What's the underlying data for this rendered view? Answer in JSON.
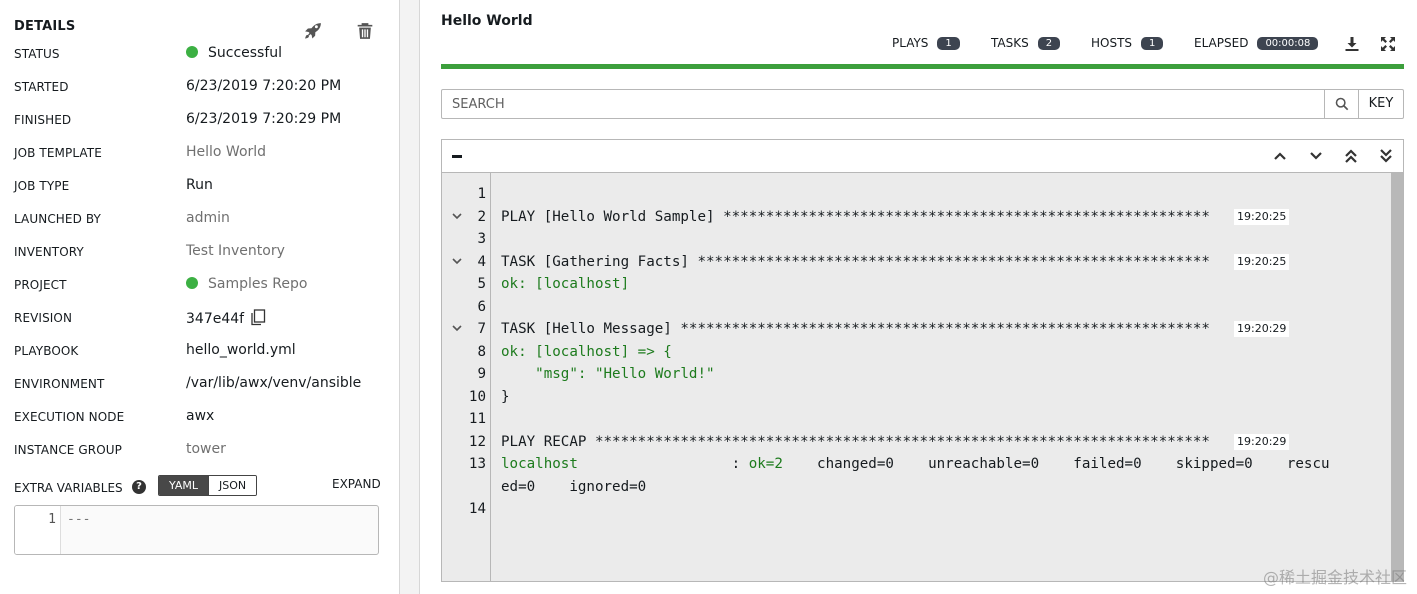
{
  "details": {
    "title": "DETAILS",
    "rows": [
      {
        "label": "STATUS",
        "value": "Successful",
        "link": false
      },
      {
        "label": "STARTED",
        "value": "6/23/2019 7:20:20 PM",
        "link": false
      },
      {
        "label": "FINISHED",
        "value": "6/23/2019 7:20:29 PM",
        "link": false
      },
      {
        "label": "JOB TEMPLATE",
        "value": "Hello World",
        "link": true
      },
      {
        "label": "JOB TYPE",
        "value": "Run",
        "link": false
      },
      {
        "label": "LAUNCHED BY",
        "value": "admin",
        "link": true
      },
      {
        "label": "INVENTORY",
        "value": "Test Inventory",
        "link": true
      },
      {
        "label": "PROJECT",
        "value": "Samples Repo",
        "link": true
      },
      {
        "label": "REVISION",
        "value": "347e44f",
        "link": false
      },
      {
        "label": "PLAYBOOK",
        "value": "hello_world.yml",
        "link": false
      },
      {
        "label": "ENVIRONMENT",
        "value": "/var/lib/awx/venv/ansible",
        "link": false
      },
      {
        "label": "EXECUTION NODE",
        "value": "awx",
        "link": false
      },
      {
        "label": "INSTANCE GROUP",
        "value": "tower",
        "link": true
      }
    ],
    "status_color": "#3cb043",
    "extra_variables": {
      "label": "EXTRA VARIABLES",
      "help": "?",
      "yaml_label": "YAML",
      "json_label": "JSON",
      "active": "YAML",
      "expand_label": "EXPAND",
      "line_number": "1",
      "content": "---"
    }
  },
  "output": {
    "title": "Hello World",
    "stats": {
      "plays_label": "PLAYS",
      "plays": "1",
      "tasks_label": "TASKS",
      "tasks": "2",
      "hosts_label": "HOSTS",
      "hosts": "1",
      "elapsed_label": "ELAPSED",
      "elapsed": "00:00:08"
    },
    "progress": 1.0,
    "progress_color": "#3c9f3c",
    "search": {
      "placeholder": "SEARCH",
      "key_label": "KEY"
    },
    "icons": [
      "download-icon",
      "fullscreen-icon",
      "search-icon",
      "chevron-up-icon",
      "chevron-down-icon",
      "double-chevron-up-icon",
      "double-chevron-down-icon"
    ],
    "log_lines": [
      {
        "n": "1",
        "text": "",
        "green": false,
        "ts": "",
        "fold": false
      },
      {
        "n": "2",
        "text": "PLAY [Hello World Sample] *********************************************************",
        "green": false,
        "ts": "19:20:25",
        "fold": true
      },
      {
        "n": "3",
        "text": "",
        "green": false,
        "ts": "",
        "fold": false
      },
      {
        "n": "4",
        "text": "TASK [Gathering Facts] ************************************************************",
        "green": false,
        "ts": "19:20:25",
        "fold": true
      },
      {
        "n": "5",
        "text": "ok: [localhost]",
        "green": true,
        "ts": "",
        "fold": false
      },
      {
        "n": "6",
        "text": "",
        "green": false,
        "ts": "",
        "fold": false
      },
      {
        "n": "7",
        "text": "TASK [Hello Message] **************************************************************",
        "green": false,
        "ts": "19:20:29",
        "fold": true
      },
      {
        "n": "8",
        "text": "ok: [localhost] => {",
        "green": true,
        "ts": "",
        "fold": false
      },
      {
        "n": "9",
        "text": "    \"msg\": \"Hello World!\"",
        "green": true,
        "ts": "",
        "fold": false
      },
      {
        "n": "10",
        "text": "}",
        "green": false,
        "ts": "",
        "fold": false
      },
      {
        "n": "11",
        "text": "",
        "green": false,
        "ts": "",
        "fold": false
      },
      {
        "n": "12",
        "text": "PLAY RECAP ************************************************************************",
        "green": false,
        "ts": "19:20:29",
        "fold": false
      },
      {
        "n": "13",
        "text": "localhost                  : ok=2    changed=0    unreachable=0    failed=0    skipped=0    rescu",
        "green": false,
        "ts": "",
        "fold": false
      },
      {
        "n": "",
        "text": "ed=0    ignored=0",
        "green": false,
        "ts": "",
        "fold": false
      },
      {
        "n": "14",
        "text": "",
        "green": false,
        "ts": "",
        "fold": false
      }
    ]
  },
  "watermark": "@稀土掘金技术社区"
}
